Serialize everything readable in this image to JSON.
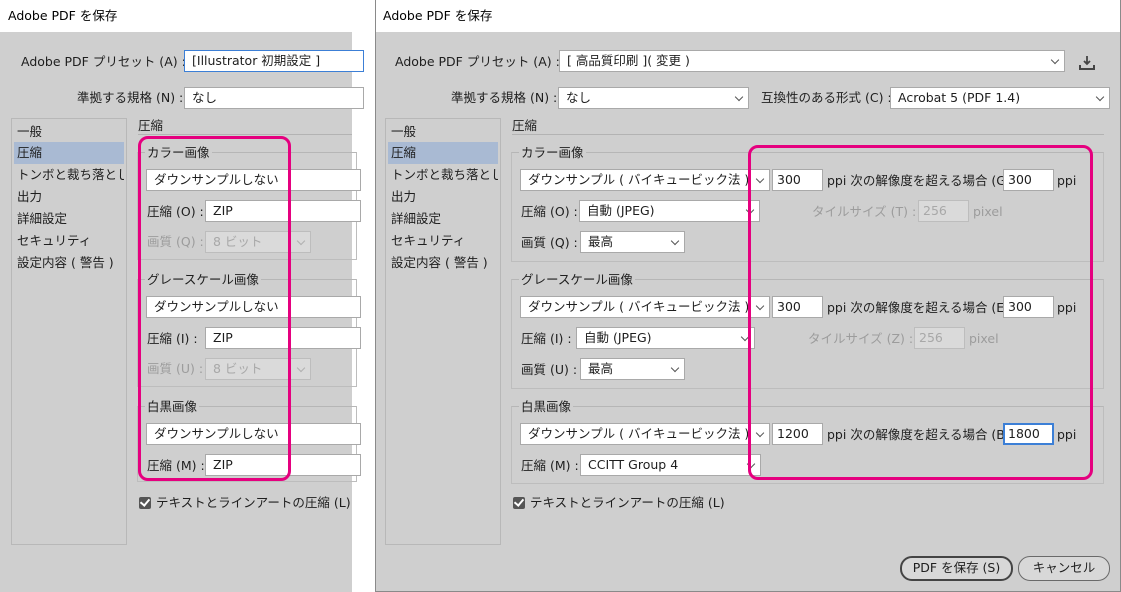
{
  "left": {
    "title": "Adobe PDF を保存",
    "preset_label": "Adobe PDF プリセット (A) :",
    "preset_value": "[Illustrator 初期設定 ]",
    "standard_label": "準拠する規格 (N) :",
    "standard_value": "なし",
    "nav": [
      "一般",
      "圧縮",
      "トンボと裁ち落とし",
      "出力",
      "詳細設定",
      "セキュリティ",
      "設定内容 ( 警告 )"
    ],
    "section_title": "圧縮",
    "color_title": "カラー画像",
    "color_downsample": "ダウンサンプルしない",
    "color_comp_label": "圧縮 (O) :",
    "color_comp_value": "ZIP",
    "color_quality_label": "画質 (Q) :",
    "color_quality_value": "8 ビット",
    "gray_title": "グレースケール画像",
    "gray_downsample": "ダウンサンプルしない",
    "gray_comp_label": "圧縮 (I) :",
    "gray_comp_value": "ZIP",
    "gray_quality_label": "画質 (U) :",
    "gray_quality_value": "8 ビット",
    "mono_title": "白黒画像",
    "mono_downsample": "ダウンサンプルしない",
    "mono_comp_label": "圧縮 (M) :",
    "mono_comp_value": "ZIP",
    "text_art_label": "テキストとラインアートの圧縮 (L)"
  },
  "right": {
    "title": "Adobe PDF を保存",
    "preset_label": "Adobe PDF プリセット (A) :",
    "preset_value": "[ 高品質印刷 ]( 変更 )",
    "standard_label": "準拠する規格 (N) :",
    "standard_value": "なし",
    "compat_label": "互換性のある形式 (C) :",
    "compat_value": "Acrobat 5 (PDF 1.4)",
    "nav": [
      "一般",
      "圧縮",
      "トンボと裁ち落とし",
      "出力",
      "詳細設定",
      "セキュリティ",
      "設定内容 ( 警告 )"
    ],
    "section_title": "圧縮",
    "ppi": "ppi",
    "pixel": "pixel",
    "color": {
      "title": "カラー画像",
      "method": "ダウンサンプル ( バイキュービック法 )",
      "res": "300",
      "above_label": "ppi 次の解像度を超える場合 (G)",
      "above_value": "300",
      "comp_label": "圧縮 (O) :",
      "comp_value": "自動 (JPEG)",
      "tile_label": "タイルサイズ (T) :",
      "tile_value": "256",
      "quality_label": "画質 (Q) :",
      "quality_value": "最高"
    },
    "gray": {
      "title": "グレースケール画像",
      "method": "ダウンサンプル ( バイキュービック法 )",
      "res": "300",
      "above_label": "ppi 次の解像度を超える場合 (E)",
      "above_value": "300",
      "comp_label": "圧縮 (I) :",
      "comp_value": "自動 (JPEG)",
      "tile_label": "タイルサイズ (Z) :",
      "tile_value": "256",
      "quality_label": "画質 (U) :",
      "quality_value": "最高"
    },
    "mono": {
      "title": "白黒画像",
      "method": "ダウンサンプル ( バイキュービック法 )",
      "res": "1200",
      "above_label": "ppi 次の解像度を超える場合 (B)",
      "above_value": "1800",
      "comp_label": "圧縮 (M) :",
      "comp_value": "CCITT Group 4"
    },
    "text_art_label": "テキストとラインアートの圧縮 (L)",
    "save_button": "PDF を保存 (S)",
    "cancel_button": "キャンセル"
  },
  "colors": {
    "highlight": "#e5007f",
    "dialog_bg": "#cfcfcf",
    "selected_nav": "#a9bad3"
  }
}
